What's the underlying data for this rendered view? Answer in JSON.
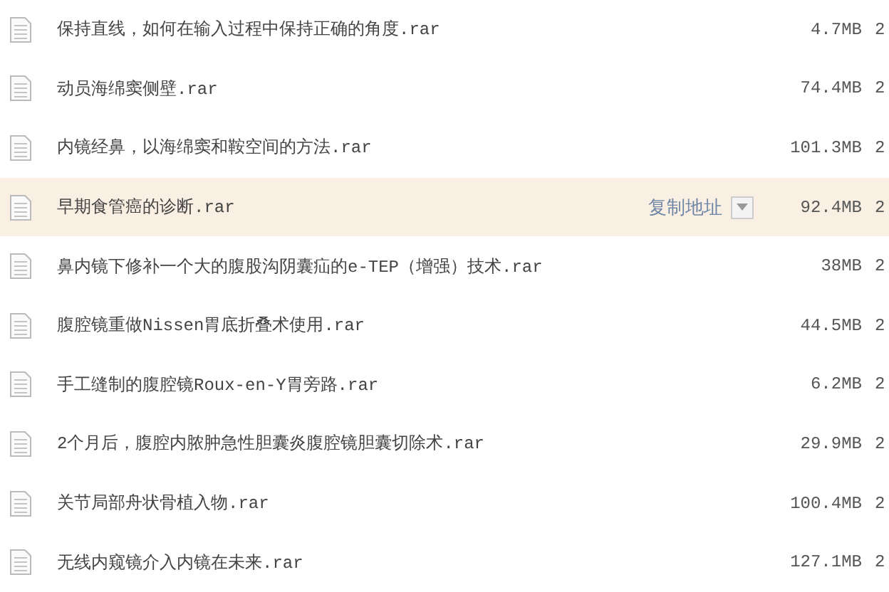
{
  "files": [
    {
      "name": "保持直线，如何在输入过程中保持正确的角度.rar",
      "size": "4.7MB",
      "column_3": "2",
      "highlighted": false
    },
    {
      "name": "动员海绵窦侧壁.rar",
      "size": "74.4MB",
      "column_3": "2",
      "highlighted": false
    },
    {
      "name": "内镜经鼻，以海绵窦和鞍空间的方法.rar",
      "size": "101.3MB",
      "column_3": "2",
      "highlighted": false
    },
    {
      "name": "早期食管癌的诊断.rar",
      "size": "92.4MB",
      "column_3": "2",
      "highlighted": true,
      "action": "复制地址"
    },
    {
      "name": "鼻内镜下修补一个大的腹股沟阴囊疝的e-TEP（增强）技术.rar",
      "size": "38MB",
      "column_3": "2",
      "highlighted": false
    },
    {
      "name": "腹腔镜重做Nissen胃底折叠术使用.rar",
      "size": "44.5MB",
      "column_3": "2",
      "highlighted": false
    },
    {
      "name": "手工缝制的腹腔镜Roux-en-Y胃旁路.rar",
      "size": "6.2MB",
      "column_3": "2",
      "highlighted": false
    },
    {
      "name": "2个月后，腹腔内脓肿急性胆囊炎腹腔镜胆囊切除术.rar",
      "size": "29.9MB",
      "column_3": "2",
      "highlighted": false
    },
    {
      "name": "关节局部舟状骨植入物.rar",
      "size": "100.4MB",
      "column_3": "2",
      "highlighted": false
    },
    {
      "name": "无线内窥镜介入内镜在未来.rar",
      "size": "127.1MB",
      "column_3": "2",
      "highlighted": false
    }
  ]
}
